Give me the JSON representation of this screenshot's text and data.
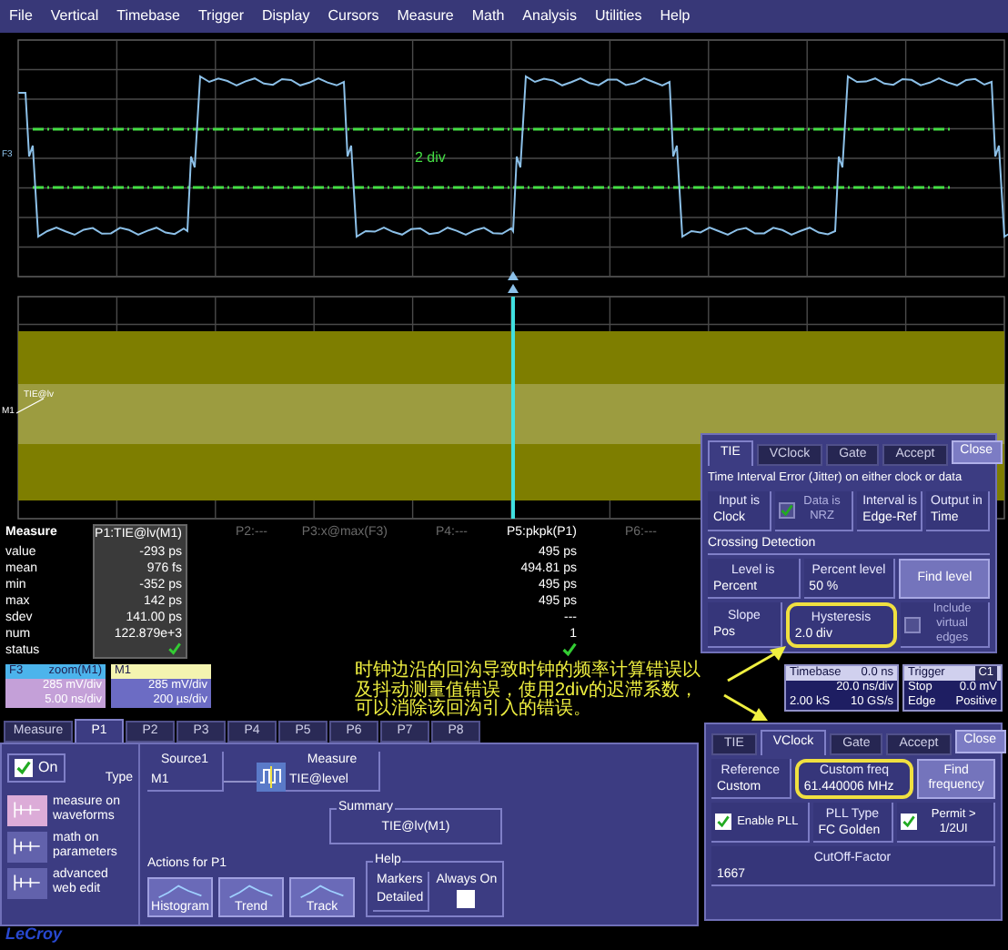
{
  "menu": [
    "File",
    "Vertical",
    "Timebase",
    "Trigger",
    "Display",
    "Cursors",
    "Measure",
    "Math",
    "Analysis",
    "Utilities",
    "Help"
  ],
  "top_plot": {
    "channel": "F3",
    "annotation": "2 div"
  },
  "zoom_plot": {
    "channel": "M1",
    "trace_label": "TIE@lv"
  },
  "tie_dialog": {
    "tabs": [
      {
        "label": "TIE",
        "selected": true
      },
      {
        "label": "VClock",
        "selected": false
      },
      {
        "label": "Gate",
        "selected": false
      },
      {
        "label": "Accept",
        "selected": false
      }
    ],
    "close": "Close",
    "rows": [
      {
        "kind": "caption",
        "text": "Time Interval Error (Jitter) on either clock or data"
      },
      {
        "kind": "controls",
        "items": [
          {
            "kind": "field",
            "label": "Input is",
            "value": "Clock",
            "highlighted": false
          },
          {
            "kind": "checkbox",
            "label": "Data is NRZ",
            "checked": true,
            "disabled": true,
            "highlighted": false
          },
          {
            "kind": "field",
            "label": "Interval is",
            "value": "Edge-Ref",
            "highlighted": false
          },
          {
            "kind": "field",
            "label": "Output in",
            "value": "Time",
            "highlighted": false
          }
        ]
      },
      {
        "kind": "section",
        "text": "Crossing Detection"
      },
      {
        "kind": "controls",
        "items": [
          {
            "kind": "field",
            "label": "Level is",
            "value": "Percent",
            "highlighted": false
          },
          {
            "kind": "field",
            "label": "Percent level",
            "value": "50 %",
            "highlighted": false
          },
          {
            "kind": "button",
            "label": "Find level",
            "highlighted": false
          }
        ]
      },
      {
        "kind": "controls",
        "items": [
          {
            "kind": "field",
            "label": "Slope",
            "value": "Pos",
            "highlighted": false
          },
          {
            "kind": "field",
            "label": "Hysteresis",
            "value": "2.0 div",
            "highlighted": true
          },
          {
            "kind": "checkbox",
            "label": "Include virtual edges",
            "checked": false,
            "disabled": true,
            "highlighted": false
          }
        ]
      }
    ]
  },
  "measure": {
    "title": "Measure",
    "row_labels": [
      "value",
      "mean",
      "min",
      "max",
      "sdev",
      "num",
      "status"
    ],
    "columns": [
      {
        "title": "P1:TIE@lv(M1)",
        "selected": true,
        "active": true,
        "values": [
          "-293 ps",
          "976 fs",
          "-352 ps",
          "142 ps",
          "141.00 ps",
          "122.879e+3"
        ],
        "status_ok": true
      },
      {
        "title": "P2:---",
        "selected": false,
        "active": false,
        "status_ok": false
      },
      {
        "title": "P3:x@max(F3)",
        "selected": false,
        "active": false,
        "status_ok": false
      },
      {
        "title": "P4:---",
        "selected": false,
        "active": false,
        "status_ok": false
      },
      {
        "title": "P5:pkpk(P1)",
        "selected": false,
        "active": true,
        "values": [
          "495 ps",
          "494.81 ps",
          "495 ps",
          "495 ps",
          "---",
          "1"
        ],
        "status_ok": true
      },
      {
        "title": "P6:---",
        "selected": false,
        "active": false,
        "status_ok": false
      }
    ]
  },
  "traces": [
    {
      "name": "F3",
      "title": "zoom(M1)",
      "lines": [
        "285 mV/div",
        "5.00 ns/div"
      ],
      "color": "#4cb4ec"
    },
    {
      "name": "M1",
      "lines": [
        "285 mV/div",
        "200 µs/div"
      ],
      "color": "#f4f4b0"
    }
  ],
  "note": "时钟边沿的回沟导致时钟的频率计算错误以及抖动测量值错误，使用2div的迟滞系数，可以消除该回沟引入的错误。",
  "timebase": {
    "title": "Timebase",
    "value": "0.0 ns",
    "lines": [
      {
        "right": "20.0 ns/div"
      },
      {
        "left": "2.00 kS",
        "right": "10 GS/s"
      }
    ]
  },
  "trigger": {
    "title": "Trigger",
    "badge": "C1",
    "lines": [
      {
        "left": "Stop",
        "right": "0.0 mV"
      },
      {
        "left": "Edge",
        "right": "Positive"
      }
    ]
  },
  "measure_panel": {
    "tabs": [
      {
        "label": "Measure",
        "selected": false
      },
      {
        "label": "P1",
        "selected": true
      },
      {
        "label": "P2",
        "selected": false
      },
      {
        "label": "P3",
        "selected": false
      },
      {
        "label": "P4",
        "selected": false
      },
      {
        "label": "P5",
        "selected": false
      },
      {
        "label": "P6",
        "selected": false
      },
      {
        "label": "P7",
        "selected": false
      },
      {
        "label": "P8",
        "selected": false
      }
    ],
    "on": {
      "label": "On",
      "checked": true
    },
    "type_label": "Type",
    "types": [
      {
        "label": "measure on waveforms",
        "selected": true
      },
      {
        "label": "math on parameters",
        "selected": false
      },
      {
        "label": "advanced web edit",
        "selected": false
      }
    ],
    "source": {
      "label": "Source1",
      "value": "M1"
    },
    "measurement": {
      "label": "Measure",
      "value": "TIE@level"
    },
    "summary": {
      "label": "Summary",
      "value": "TIE@lv(M1)"
    },
    "actions_label": "Actions for P1",
    "actions": [
      "Histogram",
      "Trend",
      "Track"
    ],
    "help": {
      "label": "Help",
      "markers_label": "Markers",
      "markers_value": "Detailed",
      "always_on_label": "Always On",
      "always_on": false
    }
  },
  "vclock_dialog": {
    "tabs": [
      {
        "label": "TIE",
        "selected": false
      },
      {
        "label": "VClock",
        "selected": true
      },
      {
        "label": "Gate",
        "selected": false
      },
      {
        "label": "Accept",
        "selected": false
      }
    ],
    "close": "Close",
    "rows": [
      {
        "kind": "controls",
        "items": [
          {
            "kind": "field",
            "label": "Reference",
            "value": "Custom",
            "highlighted": false
          },
          {
            "kind": "field",
            "label": "Custom freq",
            "value": "61.440006 MHz",
            "highlighted": true
          },
          {
            "kind": "button",
            "label": "Find frequency",
            "highlighted": false
          }
        ]
      },
      {
        "kind": "controls",
        "items": [
          {
            "kind": "checkbox",
            "label": "Enable PLL",
            "checked": true,
            "disabled": false,
            "highlighted": false
          },
          {
            "kind": "field",
            "label": "PLL Type",
            "value": "FC Golden",
            "highlighted": false
          },
          {
            "kind": "checkbox",
            "label": "Permit > 1/2UI",
            "checked": true,
            "disabled": false,
            "highlighted": false
          }
        ]
      },
      {
        "kind": "controls",
        "items": [
          {
            "kind": "field",
            "label": "CutOff-Factor",
            "value": "1667",
            "highlighted": false
          }
        ]
      }
    ]
  },
  "logo": "LeCroy"
}
